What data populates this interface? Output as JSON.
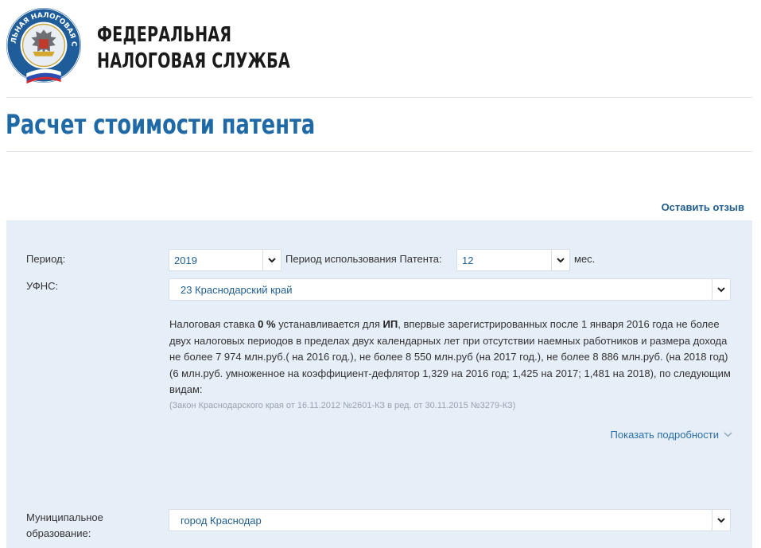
{
  "header": {
    "org_line1": "ФЕДЕРАЛЬНАЯ",
    "org_line2": "НАЛОГОВАЯ СЛУЖБА",
    "logo_icon": "fns-emblem-icon",
    "logo_text": "ФЕДЕРАЛЬНАЯ НАЛОГОВАЯ СЛУЖБА"
  },
  "page_title": "Расчет стоимости патента",
  "feedback_link": "Оставить отзыв",
  "form": {
    "period_label": "Период:",
    "period_value": "2019",
    "usage_label": "Период использования Патента:",
    "usage_value": "12",
    "usage_unit": "мес.",
    "ufns_label": "УФНС:",
    "ufns_value": "23 Краснодарский край",
    "municipal_label_1": "Муниципальное",
    "municipal_label_2": "образование:",
    "municipal_value": "город Краснодар"
  },
  "info": {
    "t1": "Налоговая ставка ",
    "rate": "0 %",
    "t2": " устанавливается для ",
    "ip": "ИП",
    "t3": ", впервые зарегистрированных после 1 января 2016 года не более двух налоговых периодов в пределах двух календарных лет при отсутствии наемных работников и размера дохода не более 7 974 млн.руб.( на 2016 год.), не более 8 550 млн.руб (на 2017 год.), не более 8 886 млн.руб. (на 2018 год) (6 млн.руб. умноженное на коэффициент-дефлятор 1,329 на 2016 год; 1,425 на 2017; 1,481 на 2018), по следующим видам:",
    "law": "(Закон Краснодарского края от 16.11.2012 №2601-КЗ в ред. от 30.11.2015 №3279-КЗ)"
  },
  "show_details": "Показать подробности",
  "colors": {
    "title_blue": "#1f6aa6",
    "link_blue": "#1f5d8f",
    "panel_bg": "#e6eef8"
  }
}
